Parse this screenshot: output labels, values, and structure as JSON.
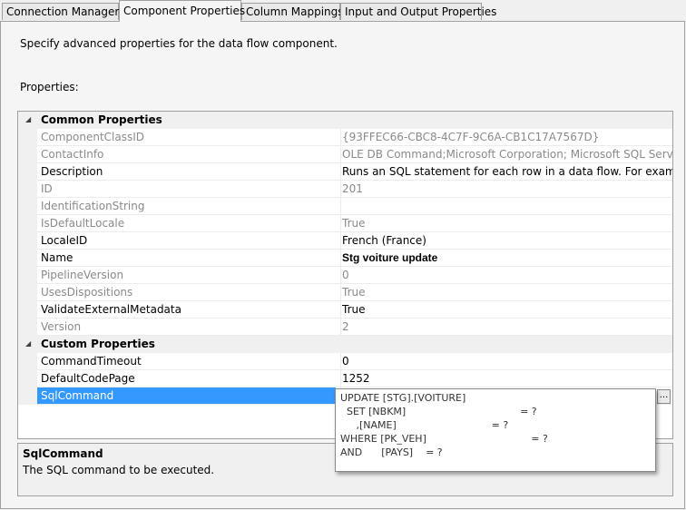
{
  "tabs": [
    {
      "label": "Connection Managers"
    },
    {
      "label": "Component Properties"
    },
    {
      "label": "Column Mappings"
    },
    {
      "label": "Input and Output Properties"
    }
  ],
  "page": {
    "description": "Specify advanced properties for the data flow component.",
    "properties_label": "Properties:"
  },
  "grid": {
    "categories": {
      "common": "Common Properties",
      "custom": "Custom Properties"
    },
    "common": [
      {
        "name": "ComponentClassID",
        "value": "{93FFEC66-CBC8-4C7F-9C6A-CB1C17A7567D}"
      },
      {
        "name": "ContactInfo",
        "value": "OLE DB Command;Microsoft Corporation; Microsoft SQL Server; (C) Microsoft Corporation"
      },
      {
        "name": "Description",
        "value": "Runs an SQL statement for each row in a data flow. For example, call a stored procedure"
      },
      {
        "name": "ID",
        "value": "201"
      },
      {
        "name": "IdentificationString",
        "value": ""
      },
      {
        "name": "IsDefaultLocale",
        "value": "True"
      },
      {
        "name": "LocaleID",
        "value": "French (France)"
      },
      {
        "name": "Name",
        "value": "Stg voiture update"
      },
      {
        "name": "PipelineVersion",
        "value": "0"
      },
      {
        "name": "UsesDispositions",
        "value": "True"
      },
      {
        "name": "ValidateExternalMetadata",
        "value": "True"
      },
      {
        "name": "Version",
        "value": "2"
      }
    ],
    "custom": [
      {
        "name": "CommandTimeout",
        "value": "0"
      },
      {
        "name": "DefaultCodePage",
        "value": "1252"
      },
      {
        "name": "SqlCommand",
        "value": ""
      }
    ]
  },
  "sql_editor": {
    "text": "UPDATE [STG].[VOITURE]\n  SET [NBKM]                                    = ?\n     ,[NAME]                              = ?\nWHERE [PK_VEH]                                 = ?\nAND      [PAYS]    = ?",
    "ellipsis_label": "..."
  },
  "description_pane": {
    "title": "SqlCommand",
    "body": "The SQL command to be executed."
  }
}
